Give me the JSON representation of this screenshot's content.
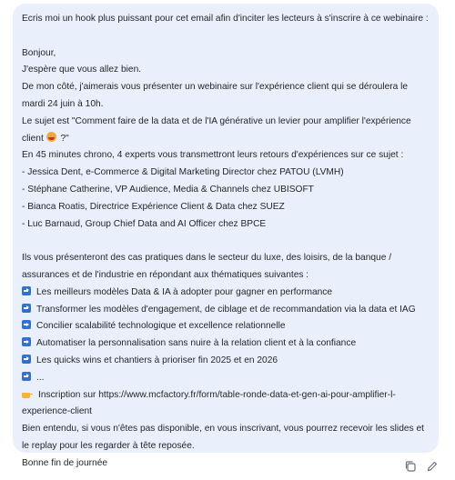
{
  "message": {
    "prompt": "Ecris moi un hook plus puissant pour cet email afin d'inciter les lecteurs à s'inscrire à ce webinaire :",
    "greeting": "Bonjour,",
    "intro_1": "J'espère que vous allez bien.",
    "intro_2": "De mon côté, j'aimerais vous présenter un webinaire sur l'expérience client qui se déroulera le",
    "intro_3": "mardi 24 juin à 10h.",
    "subject_1": "Le sujet est \"Comment faire de la data et de l'IA générative un levier pour amplifier l'expérience",
    "subject_2_prefix": "client",
    "subject_2_suffix": " ?\"",
    "experts_intro": "En 45 minutes chrono, 4 experts vous transmettront leurs retours d'expériences sur ce sujet :",
    "experts": [
      "- Jessica Dent, e-Commerce & Digital Marketing Director chez PATOU (LVMH)",
      "- Stéphane Catherine, VP Audience, Media & Channels chez UBISOFT",
      "- Bianca Roatis, Directrice Expérience Client & Data chez SUEZ",
      "- Luc Barnaud, Group Chief Data and AI Officer chez BPCE"
    ],
    "cases_1": "Ils vous présenteront des cas pratiques dans le secteur du luxe, des loisirs, de la banque /",
    "cases_2": "assurances et de l'industrie en répondant aux thématiques suivantes :",
    "themes": [
      "Les meilleurs modèles Data & IA à adopter pour gagner en performance",
      "Transformer les modèles d'engagement, de ciblage et de recommandation via la data et IAG",
      "Concilier scalabilité technologique et excellence relationnelle",
      "Automatiser la personnalisation sans nuire à la relation client et à la confiance",
      "Les quicks wins et chantiers à prioriser fin 2025 et en 2026",
      "..."
    ],
    "signup_1": "Inscription sur https://www.mcfactory.fr/form/table-ronde-data-et-gen-ai-pour-amplifier-l-",
    "signup_2": "experience-client",
    "closing_1": "Bien entendu, si vous n'êtes pas disponible, en vous inscrivant, vous pourrez recevoir les slides et",
    "closing_2": "le replay pour les regarder à tête reposée.",
    "signoff": "Bonne fin de journée"
  },
  "actions": {
    "copy_icon": "copy-icon",
    "edit_icon": "edit-pencil-icon"
  },
  "colors": {
    "bubble": "#eaf0fb",
    "bullet": "#2f6fd6"
  }
}
